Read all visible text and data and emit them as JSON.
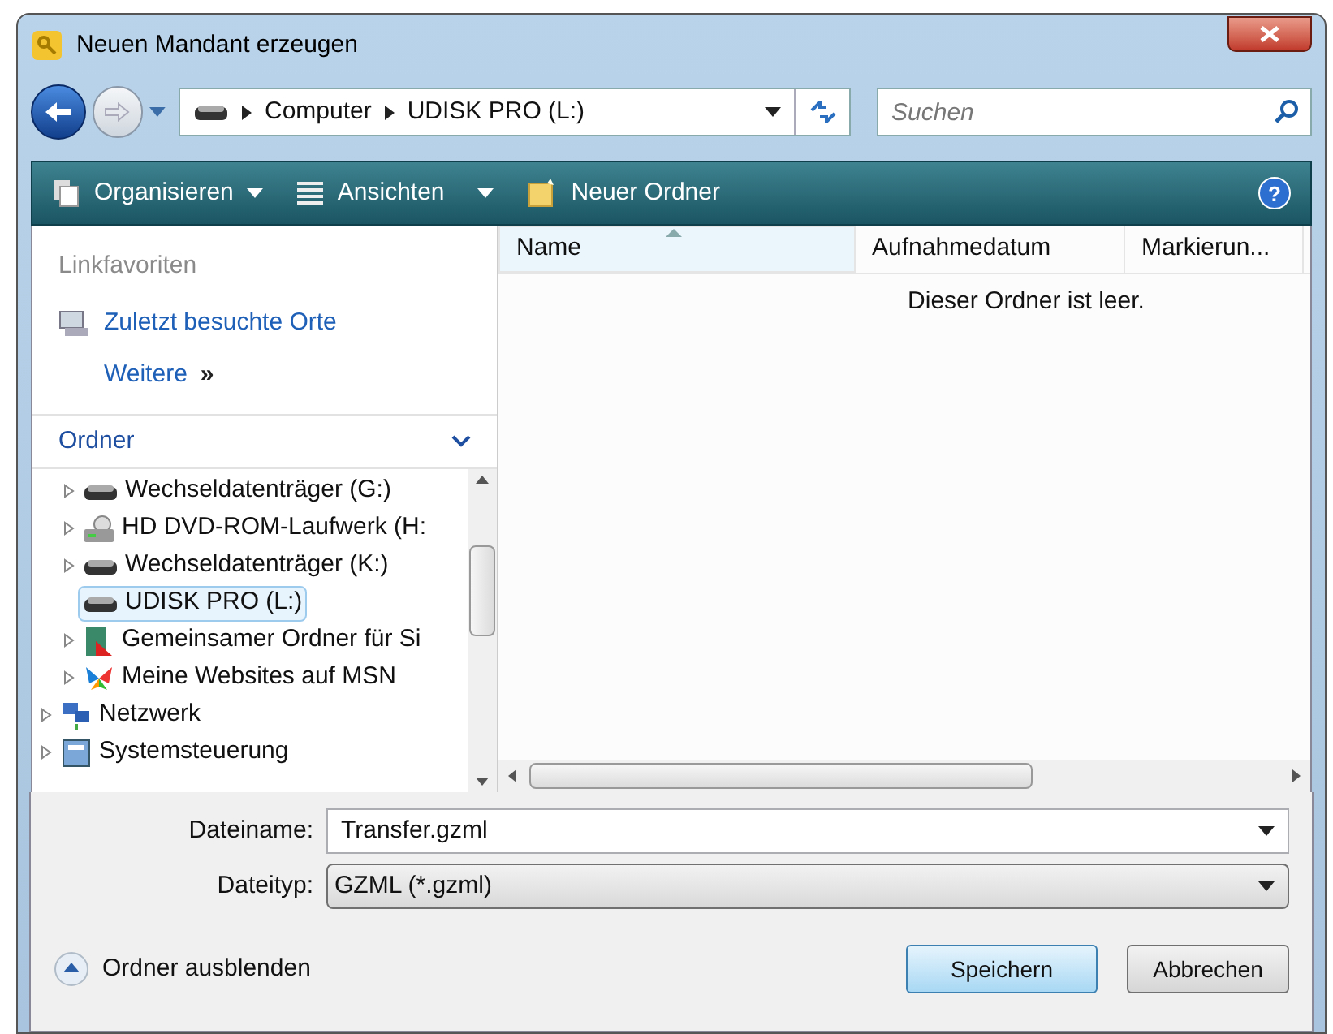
{
  "window": {
    "title": "Neuen Mandant erzeugen"
  },
  "address_bar": {
    "segments": [
      "Computer",
      "UDISK PRO (L:)"
    ]
  },
  "search": {
    "placeholder": "Suchen"
  },
  "toolbar": {
    "items": [
      "Organisieren",
      "Ansichten",
      "Neuer Ordner"
    ],
    "help_glyph": "?"
  },
  "favorites": {
    "heading": "Linkfavoriten",
    "links": [
      "Zuletzt besuchte Orte"
    ],
    "more": "Weitere",
    "more_glyph": "»"
  },
  "folders": {
    "heading": "Ordner",
    "expanded": true,
    "tree": [
      {
        "expanded": true,
        "children": [
          {
            "label": "Wechseldatenträger (G:)",
            "kind": "drive",
            "expandable": true,
            "selected": false
          },
          {
            "label": "HD DVD-ROM-Laufwerk (H:",
            "kind": "dvd",
            "expandable": true,
            "selected": false
          },
          {
            "label": "Wechseldatenträger (K:)",
            "kind": "drive",
            "expandable": true,
            "selected": false
          },
          {
            "label": "UDISK PRO (L:)",
            "kind": "drive",
            "expandable": false,
            "selected": true
          },
          {
            "label": "Gemeinsamer Ordner für Si",
            "kind": "shared",
            "expandable": true,
            "selected": false
          },
          {
            "label": "Meine Websites auf MSN",
            "kind": "msn",
            "expandable": true,
            "selected": false
          }
        ]
      },
      {
        "label": "Netzwerk",
        "kind": "network",
        "expandable": true,
        "selected": false
      },
      {
        "label": "Systemsteuerung",
        "kind": "control",
        "expandable": true,
        "selected": false
      }
    ]
  },
  "file_list": {
    "columns": [
      {
        "label": "Name",
        "sorted": true
      },
      {
        "label": "Aufnahmedatum",
        "sorted": false
      },
      {
        "label": "Markierun...",
        "sorted": false
      }
    ],
    "empty_message": "Dieser Ordner ist leer."
  },
  "filename": {
    "label": "Dateiname:",
    "value": "Transfer.gzml"
  },
  "filetype": {
    "label": "Dateityp:",
    "value": "GZML (*.gzml)"
  },
  "hide_folders": "Ordner ausblenden",
  "buttons": [
    {
      "label": "Speichern",
      "default": true
    },
    {
      "label": "Abbrechen",
      "default": false
    }
  ]
}
